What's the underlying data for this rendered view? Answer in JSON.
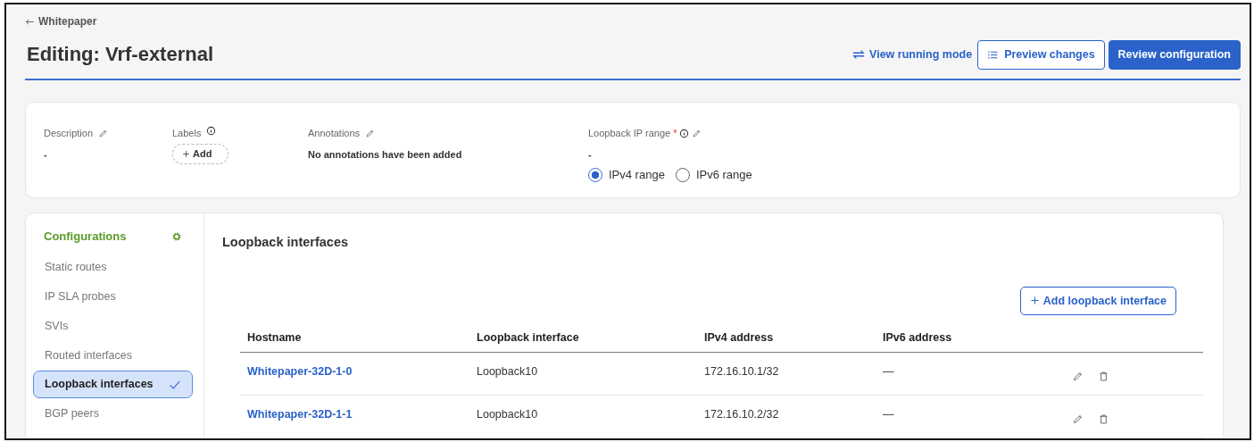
{
  "back_link": "Whitepaper",
  "title": "Editing: Vrf-external",
  "actions": [
    {
      "kind": "link",
      "label": "View running mode"
    },
    {
      "kind": "outline",
      "label": "Preview changes"
    },
    {
      "kind": "primary",
      "label": "Review configuration"
    }
  ],
  "summary": {
    "description": {
      "label": "Description",
      "value": "-"
    },
    "labels": {
      "label": "Labels",
      "add_button": "Add"
    },
    "annotations": {
      "label": "Annotations",
      "value": "No annotations have been added"
    },
    "loopback_range": {
      "label": "Loopback IP range",
      "required_mark": "*",
      "value": "-",
      "options": [
        {
          "label": "IPv4 range",
          "selected": true
        },
        {
          "label": "IPv6 range",
          "selected": false
        }
      ]
    }
  },
  "sidebar": {
    "title": "Configurations",
    "items": [
      {
        "label": "Static routes",
        "selected": false
      },
      {
        "label": "IP SLA probes",
        "selected": false
      },
      {
        "label": "SVIs",
        "selected": false
      },
      {
        "label": "Routed interfaces",
        "selected": false
      },
      {
        "label": "Loopback interfaces",
        "selected": true
      },
      {
        "label": "BGP peers",
        "selected": false
      }
    ]
  },
  "section_title": "Loopback interfaces",
  "add_button": "Add loopback interface",
  "table": {
    "columns": [
      "Hostname",
      "Loopback interface",
      "IPv4 address",
      "IPv6 address"
    ],
    "rows": [
      {
        "hostname": "Whitepaper-32D-1-0",
        "loopback": "Loopback10",
        "ipv4": "172.16.10.1/32",
        "ipv6": "—"
      },
      {
        "hostname": "Whitepaper-32D-1-1",
        "loopback": "Loopback10",
        "ipv4": "172.16.10.2/32",
        "ipv6": "—"
      }
    ]
  }
}
